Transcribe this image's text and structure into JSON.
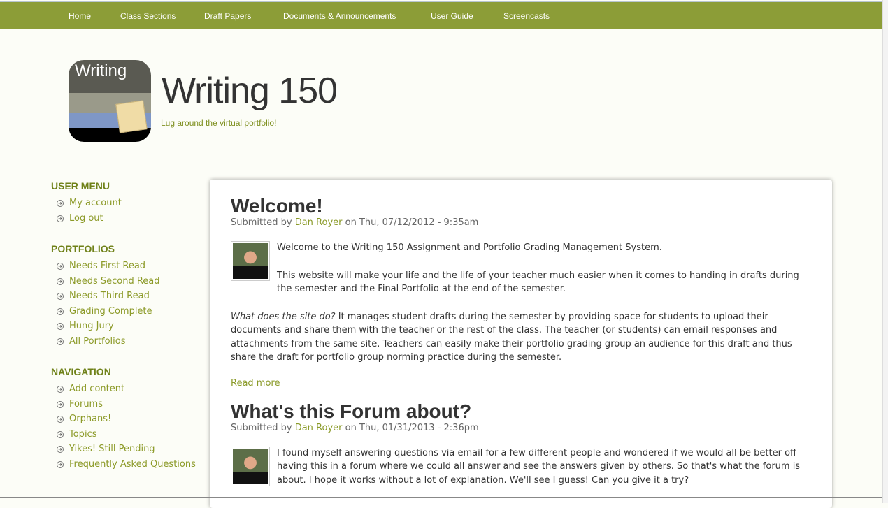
{
  "nav": [
    "Home",
    "Class Sections",
    "Draft Papers",
    "Documents & Announcements",
    "User Guide",
    "Screencasts"
  ],
  "site": {
    "logo_text": "Writing",
    "name": "Writing 150",
    "slogan": "Lug around the virtual portfolio!"
  },
  "sidebar": [
    {
      "title": "USER MENU",
      "items": [
        "My account",
        "Log out"
      ]
    },
    {
      "title": "PORTFOLIOS",
      "items": [
        "Needs First Read",
        "Needs Second Read",
        "Needs Third Read",
        "Grading Complete",
        "Hung Jury",
        "All Portfolios"
      ]
    },
    {
      "title": "NAVIGATION",
      "items": [
        "Add content",
        "Forums",
        "Orphans!",
        "Topics",
        "Yikes! Still Pending",
        "Frequently Asked Questions"
      ]
    }
  ],
  "nodes": [
    {
      "title": "Welcome!",
      "submitted_by": "Submitted by",
      "author": "Dan Royer",
      "date": "on Thu, 07/12/2012 - 9:35am",
      "p1": "Welcome to the Writing 150 Assignment and Portfolio Grading Management System.",
      "p2": "This website will make your life and the life of your teacher much easier when it comes to handing in drafts during the semester and the Final Portfolio at the end of the semester.",
      "p3_em": "What does the site do?",
      "p3": " It manages student drafts during the semester by providing space for students to upload their documents and share them with the teacher or the rest of the class. The teacher (or students) can email responses and attachments from the same site. Teachers can easily make their portfolio grading group an audience for this draft and thus share the draft for portfolio group norming practice during the semester.",
      "read_more": "Read more"
    },
    {
      "title": "What's this Forum about?",
      "submitted_by": "Submitted by",
      "author": "Dan Royer",
      "date": "on Thu, 01/31/2013 - 2:36pm",
      "p1": "I found myself answering questions via email for a few different people and wondered if we would all be better off having this in a forum where we could all answer and see the answers given by others. So that's what the forum is about. I hope it works without a lot of explanation. We'll see I guess! Can you give it a try?"
    }
  ]
}
